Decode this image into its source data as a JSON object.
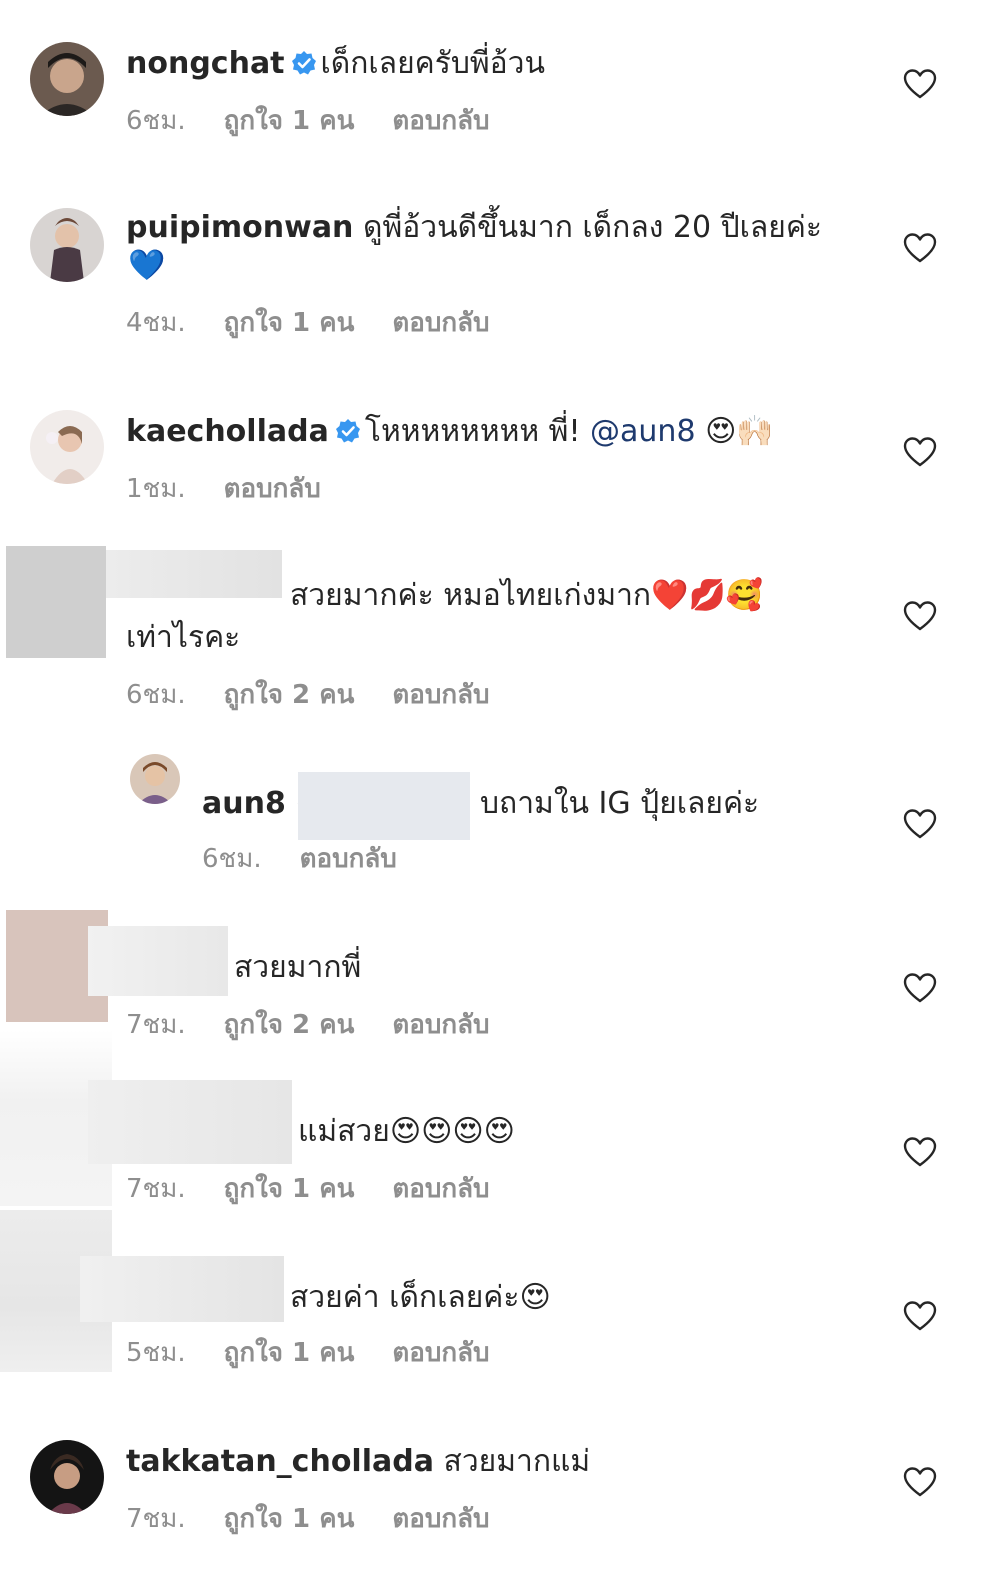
{
  "comments": [
    {
      "username": "nongchat",
      "verified": true,
      "text": "เด็กเลยครับพี่อ้วน",
      "time": "6ชม.",
      "likes": "ถูกใจ 1 คน",
      "reply": "ตอบกลับ"
    },
    {
      "username": "puipimonwan",
      "text": "ดูพี่อ้วนดีขึ้นมาก เด็กลง 20 ปีเลยค่ะ",
      "emoji": "💙",
      "time": "4ชม.",
      "likes": "ถูกใจ 1 คน",
      "reply": "ตอบกลับ"
    },
    {
      "username": "kaechollada",
      "verified": true,
      "text": "โหหหหหหหห พี่!",
      "mention": "@aun8",
      "emoji": "😍🙌🏻",
      "time": "1ชม.",
      "reply": "ตอบกลับ"
    },
    {
      "username": "",
      "text": "สวยมากค่ะ หมอไทยเก่งมาก",
      "emoji": "❤️💋🥰",
      "text2": "เท่าไรคะ",
      "time": "6ชม.",
      "likes": "ถูกใจ 2 คน",
      "reply": "ตอบกลับ"
    },
    {
      "username": "aun8",
      "text_prefix": "(",
      "text": "บถามใน IG ปุ้ยเลยค่ะ",
      "time": "6ชม.",
      "reply": "ตอบกลับ"
    },
    {
      "username": "",
      "text": "สวยมากพี่",
      "time": "7ชม.",
      "likes": "ถูกใจ 2 คน",
      "reply": "ตอบกลับ"
    },
    {
      "username": "",
      "text": "แม่สวย",
      "emoji": "😍😍😍😍",
      "time": "7ชม.",
      "likes": "ถูกใจ 1 คน",
      "reply": "ตอบกลับ"
    },
    {
      "username": "",
      "text": "สวยค่า เด็กเลยค่ะ",
      "emoji": "😍",
      "time": "5ชม.",
      "likes": "ถูกใจ 1 คน",
      "reply": "ตอบกลับ"
    },
    {
      "username": "takkatan_chollada",
      "text": "สวยมากแม่",
      "time": "7ชม.",
      "likes": "ถูกใจ 1 คน",
      "reply": "ตอบกลับ"
    }
  ],
  "icons": {
    "like": "heart-outline-icon",
    "verified": "verified-badge-icon"
  },
  "colors": {
    "text": "#262626",
    "meta": "#8e8e8e",
    "verified": "#3897f0",
    "mention": "#1e3a6e",
    "heart": "#262626"
  }
}
